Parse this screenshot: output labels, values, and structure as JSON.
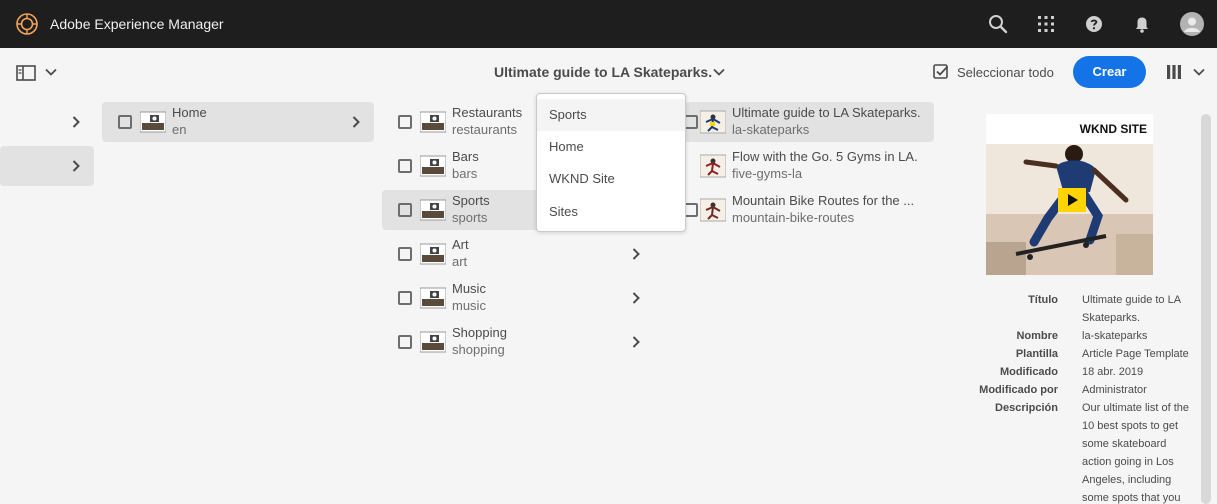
{
  "app": {
    "title": "Adobe Experience Manager"
  },
  "header_icons": [
    "search-icon",
    "apps-grid-icon",
    "help-icon",
    "notifications-icon",
    "user-avatar-icon"
  ],
  "actionbar": {
    "title": "Ultimate guide to LA Skateparks.",
    "select_all": "Seleccionar todo",
    "create": "Crear"
  },
  "colors": {
    "accent": "#1473e6",
    "topbar": "#1e1e1e"
  },
  "col1": [
    {
      "title": "Home",
      "name": "en"
    }
  ],
  "col2": [
    {
      "title": "Restaurants",
      "name": "restaurants"
    },
    {
      "title": "Bars",
      "name": "bars"
    },
    {
      "title": "Sports",
      "name": "sports"
    },
    {
      "title": "Art",
      "name": "art"
    },
    {
      "title": "Music",
      "name": "music"
    },
    {
      "title": "Shopping",
      "name": "shopping"
    }
  ],
  "col3": [
    {
      "title": "Ultimate guide to LA Skateparks.",
      "name": "la-skateparks"
    },
    {
      "title": "Flow with the Go. 5 Gyms in LA.",
      "name": "five-gyms-la"
    },
    {
      "title": "Mountain Bike Routes for the ...",
      "name": "mountain-bike-routes"
    }
  ],
  "breadcrumb_menu": [
    "Sports",
    "Home",
    "WKND Site",
    "Sites"
  ],
  "preview": {
    "brand": "WKND SITE",
    "labels": {
      "title": "Título",
      "name": "Nombre",
      "template": "Plantilla",
      "modified": "Modificado",
      "modified_by": "Modificado por",
      "description": "Descripción"
    },
    "values": {
      "title_line1": "Ultimate guide to LA",
      "title_line2": "Skateparks.",
      "name": "la-skateparks",
      "template": "Article Page Template",
      "modified": "18 abr. 2019",
      "modified_by": "Administrator",
      "description": [
        "Our ultimate list of the",
        "10 best spots to get",
        "some skateboard",
        "action going in Los",
        "Angeles, including",
        "some spots that you"
      ]
    }
  }
}
